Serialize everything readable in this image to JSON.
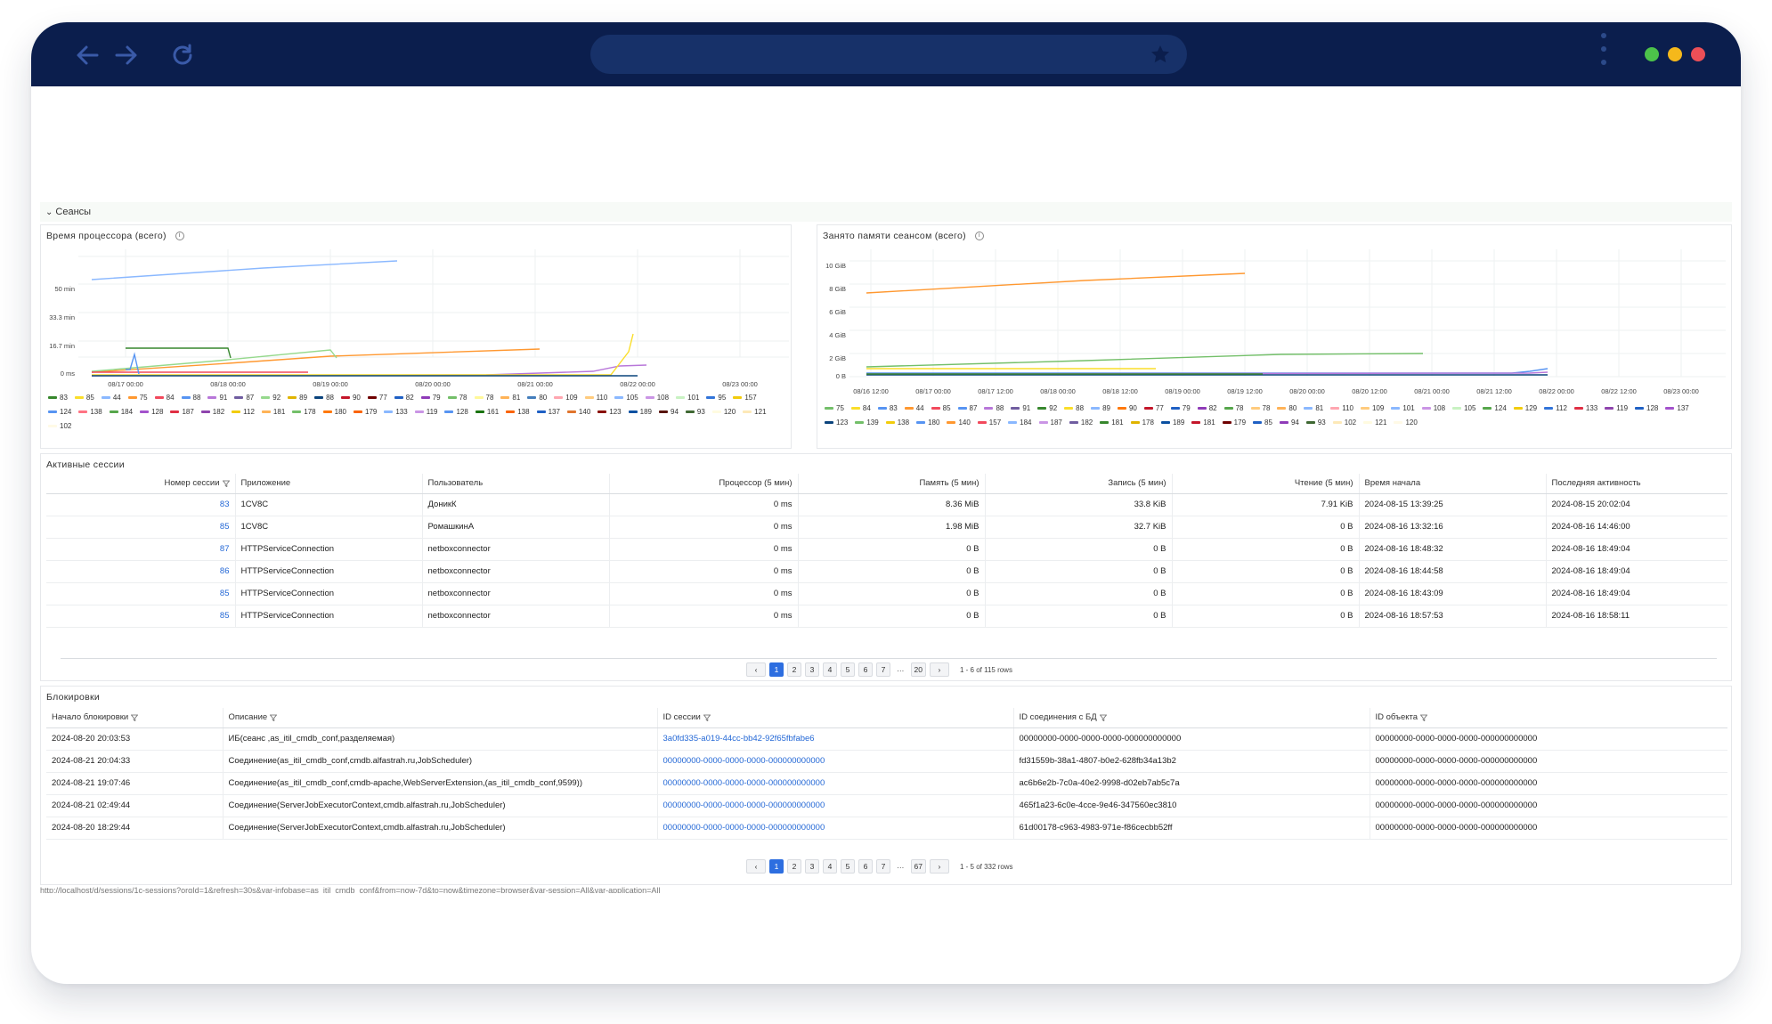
{
  "colors": {
    "titlebar": "#0b1e4d",
    "address_bar": "#173169",
    "accent": "#2d6ee0",
    "link": "#2468d6",
    "traffic_green": "#4cc24a",
    "traffic_yellow": "#f5b81b",
    "traffic_red": "#ec4f57"
  },
  "browser": {
    "icons": [
      "back-arrow-icon",
      "forward-arrow-icon",
      "reload-icon",
      "star-icon",
      "kebab-menu-icon"
    ]
  },
  "row": {
    "title": "Сеансы",
    "icon": "chevron-down-icon"
  },
  "cpu_panel": {
    "title": "Время процессора (всего)",
    "y_ticks": [
      "50 min",
      "33.3 min",
      "16.7 min",
      "0 ms"
    ],
    "x_ticks": [
      "08/17 00:00",
      "08/18 00:00",
      "08/19 00:00",
      "08/20 00:00",
      "08/21 00:00",
      "08/22 00:00",
      "08/23 00:00"
    ],
    "legend": [
      {
        "label": "83",
        "color": "#37872d"
      },
      {
        "label": "85",
        "color": "#fade2a"
      },
      {
        "label": "44",
        "color": "#8ab8ff"
      },
      {
        "label": "75",
        "color": "#ff9830"
      },
      {
        "label": "84",
        "color": "#f2495c"
      },
      {
        "label": "88",
        "color": "#5794f2"
      },
      {
        "label": "91",
        "color": "#b877d9"
      },
      {
        "label": "87",
        "color": "#705da0"
      },
      {
        "label": "92",
        "color": "#96d98d"
      },
      {
        "label": "89",
        "color": "#e0b400"
      },
      {
        "label": "88",
        "color": "#0a437c"
      },
      {
        "label": "90",
        "color": "#c4162a"
      },
      {
        "label": "77",
        "color": "#6f0000"
      },
      {
        "label": "82",
        "color": "#1f60c4"
      },
      {
        "label": "79",
        "color": "#8f3bb8"
      },
      {
        "label": "78",
        "color": "#73bf69"
      },
      {
        "label": "78",
        "color": "#fff899"
      },
      {
        "label": "81",
        "color": "#ffb357"
      },
      {
        "label": "80",
        "color": "#447ebc"
      },
      {
        "label": "109",
        "color": "#ffa6b0"
      },
      {
        "label": "110",
        "color": "#ffcb7d"
      },
      {
        "label": "105",
        "color": "#8ab8ff"
      },
      {
        "label": "108",
        "color": "#ca95e5"
      },
      {
        "label": "101",
        "color": "#c8f2c2"
      },
      {
        "label": "95",
        "color": "#3274d9"
      },
      {
        "label": "157",
        "color": "#f2cc0c"
      },
      {
        "label": "124",
        "color": "#5794f2"
      },
      {
        "label": "138",
        "color": "#ff7383"
      },
      {
        "label": "184",
        "color": "#56a64b"
      },
      {
        "label": "128",
        "color": "#a352cc"
      },
      {
        "label": "187",
        "color": "#e02f44"
      },
      {
        "label": "182",
        "color": "#8e44ad"
      },
      {
        "label": "112",
        "color": "#f2cc0c"
      },
      {
        "label": "181",
        "color": "#ffb357"
      },
      {
        "label": "178",
        "color": "#73bf69"
      },
      {
        "label": "180",
        "color": "#ff780a"
      },
      {
        "label": "179",
        "color": "#fa6400"
      },
      {
        "label": "133",
        "color": "#8ab8ff"
      },
      {
        "label": "119",
        "color": "#ca95e5"
      },
      {
        "label": "128",
        "color": "#5794f2"
      },
      {
        "label": "161",
        "color": "#19730e"
      },
      {
        "label": "138",
        "color": "#fa6400"
      },
      {
        "label": "137",
        "color": "#1f60c4"
      },
      {
        "label": "140",
        "color": "#e0752d"
      },
      {
        "label": "123",
        "color": "#890f02"
      },
      {
        "label": "189",
        "color": "#0a50a1"
      },
      {
        "label": "94",
        "color": "#58140c"
      },
      {
        "label": "93",
        "color": "#3f6833"
      },
      {
        "label": "120",
        "color": "#fffbe0"
      },
      {
        "label": "121",
        "color": "#fde9b8"
      },
      {
        "label": "102",
        "color": "#fffae6"
      }
    ]
  },
  "mem_panel": {
    "title": "Занято памяти сеансом (всего)",
    "y_ticks": [
      "10 GiB",
      "8 GiB",
      "6 GiB",
      "4 GiB",
      "2 GiB",
      "0 B"
    ],
    "x_ticks": [
      "08/16 12:00",
      "08/17 00:00",
      "08/17 12:00",
      "08/18 00:00",
      "08/18 12:00",
      "08/19 00:00",
      "08/19 12:00",
      "08/20 00:00",
      "08/20 12:00",
      "08/21 00:00",
      "08/21 12:00",
      "08/22 00:00",
      "08/22 12:00",
      "08/23 00:00"
    ],
    "legend": [
      {
        "label": "75",
        "color": "#73bf69"
      },
      {
        "label": "84",
        "color": "#fade2a"
      },
      {
        "label": "83",
        "color": "#5794f2"
      },
      {
        "label": "44",
        "color": "#ff9830"
      },
      {
        "label": "85",
        "color": "#f2495c"
      },
      {
        "label": "87",
        "color": "#5794f2"
      },
      {
        "label": "88",
        "color": "#b877d9"
      },
      {
        "label": "91",
        "color": "#705da0"
      },
      {
        "label": "92",
        "color": "#37872d"
      },
      {
        "label": "88",
        "color": "#fade2a"
      },
      {
        "label": "89",
        "color": "#8ab8ff"
      },
      {
        "label": "90",
        "color": "#ff780a"
      },
      {
        "label": "77",
        "color": "#c4162a"
      },
      {
        "label": "79",
        "color": "#1f60c4"
      },
      {
        "label": "82",
        "color": "#8f3bb8"
      },
      {
        "label": "78",
        "color": "#56a64b"
      },
      {
        "label": "78",
        "color": "#ffcb7d"
      },
      {
        "label": "80",
        "color": "#ffb357"
      },
      {
        "label": "81",
        "color": "#8ab8ff"
      },
      {
        "label": "110",
        "color": "#ffa6b0"
      },
      {
        "label": "109",
        "color": "#ffcb7d"
      },
      {
        "label": "101",
        "color": "#8ab8ff"
      },
      {
        "label": "108",
        "color": "#ca95e5"
      },
      {
        "label": "105",
        "color": "#c8f2c2"
      },
      {
        "label": "124",
        "color": "#56a64b"
      },
      {
        "label": "129",
        "color": "#f2cc0c"
      },
      {
        "label": "112",
        "color": "#3274d9"
      },
      {
        "label": "133",
        "color": "#e02f44"
      },
      {
        "label": "119",
        "color": "#8e44ad"
      },
      {
        "label": "128",
        "color": "#1f60c4"
      },
      {
        "label": "137",
        "color": "#a352cc"
      },
      {
        "label": "123",
        "color": "#0a437c"
      },
      {
        "label": "139",
        "color": "#73bf69"
      },
      {
        "label": "138",
        "color": "#f2cc0c"
      },
      {
        "label": "180",
        "color": "#5794f2"
      },
      {
        "label": "140",
        "color": "#ff9830"
      },
      {
        "label": "157",
        "color": "#f2495c"
      },
      {
        "label": "184",
        "color": "#8ab8ff"
      },
      {
        "label": "187",
        "color": "#ca95e5"
      },
      {
        "label": "182",
        "color": "#705da0"
      },
      {
        "label": "181",
        "color": "#37872d"
      },
      {
        "label": "178",
        "color": "#e0b400"
      },
      {
        "label": "189",
        "color": "#0a50a1"
      },
      {
        "label": "181",
        "color": "#c4162a"
      },
      {
        "label": "179",
        "color": "#6f0000"
      },
      {
        "label": "85",
        "color": "#1f60c4"
      },
      {
        "label": "94",
        "color": "#8f3bb8"
      },
      {
        "label": "93",
        "color": "#3f6833"
      },
      {
        "label": "102",
        "color": "#fde9b8"
      },
      {
        "label": "121",
        "color": "#fffbe0"
      },
      {
        "label": "120",
        "color": "#fffae6"
      }
    ]
  },
  "sessions": {
    "title": "Активные сессии",
    "columns": [
      "Номер сессии",
      "Приложение",
      "Пользователь",
      "Процессор (5 мин)",
      "Память (5 мин)",
      "Запись (5 мин)",
      "Чтение (5 мин)",
      "Время начала",
      "Последняя активность"
    ],
    "rows": [
      [
        "83",
        "1CV8C",
        "ДоникК",
        "0 ms",
        "8.36 MiB",
        "33.8 KiB",
        "7.91 KiB",
        "2024-08-15 13:39:25",
        "2024-08-15 20:02:04"
      ],
      [
        "85",
        "1CV8C",
        "РомашкинА",
        "0 ms",
        "1.98 MiB",
        "32.7 KiB",
        "0 B",
        "2024-08-16 13:32:16",
        "2024-08-16 14:46:00"
      ],
      [
        "87",
        "HTTPServiceConnection",
        "netboxconnector",
        "0 ms",
        "0 B",
        "0 B",
        "0 B",
        "2024-08-16 18:48:32",
        "2024-08-16 18:49:04"
      ],
      [
        "86",
        "HTTPServiceConnection",
        "netboxconnector",
        "0 ms",
        "0 B",
        "0 B",
        "0 B",
        "2024-08-16 18:44:58",
        "2024-08-16 18:49:04"
      ],
      [
        "85",
        "HTTPServiceConnection",
        "netboxconnector",
        "0 ms",
        "0 B",
        "0 B",
        "0 B",
        "2024-08-16 18:43:09",
        "2024-08-16 18:49:04"
      ],
      [
        "85",
        "HTTPServiceConnection",
        "netboxconnector",
        "0 ms",
        "0 B",
        "0 B",
        "0 B",
        "2024-08-16 18:57:53",
        "2024-08-16 18:58:11"
      ]
    ],
    "pager": {
      "pages": [
        "1",
        "2",
        "3",
        "4",
        "5",
        "6",
        "7",
        "…",
        "20"
      ],
      "active": "1",
      "info": "1 - 6 of 115 rows",
      "prev": "‹",
      "next": "›"
    }
  },
  "locks": {
    "title": "Блокировки",
    "columns": [
      "Начало блокировки",
      "Описание",
      "ID сессии",
      "ID соединения с БД",
      "ID объекта"
    ],
    "rows": [
      [
        "2024-08-20 20:03:53",
        "ИБ(сеанс ,as_itil_cmdb_conf,разделяемая)",
        "3a0fd335-a019-44cc-bb42-92f65fbfabe6",
        "00000000-0000-0000-0000-000000000000",
        "00000000-0000-0000-0000-000000000000"
      ],
      [
        "2024-08-21 20:04:33",
        "Соединение(as_itil_cmdb_conf,cmdb.alfastrah.ru,JobScheduler)",
        "00000000-0000-0000-0000-000000000000",
        "fd31559b-38a1-4807-b0e2-628fb34a13b2",
        "00000000-0000-0000-0000-000000000000"
      ],
      [
        "2024-08-21 19:07:46",
        "Соединение(as_itil_cmdb_conf,cmdb-apache,WebServerExtension,(as_itil_cmdb_conf,9599))",
        "00000000-0000-0000-0000-000000000000",
        "ac6b6e2b-7c0a-40e2-9998-d02eb7ab5c7a",
        "00000000-0000-0000-0000-000000000000"
      ],
      [
        "2024-08-21 02:49:44",
        "Соединение(ServerJobExecutorContext,cmdb.alfastrah.ru,JobScheduler)",
        "00000000-0000-0000-0000-000000000000",
        "465f1a23-6c0e-4cce-9e46-347560ec3810",
        "00000000-0000-0000-0000-000000000000"
      ],
      [
        "2024-08-20 18:29:44",
        "Соединение(ServerJobExecutorContext,cmdb.alfastrah.ru,JobScheduler)",
        "00000000-0000-0000-0000-000000000000",
        "61d00178-c963-4983-971e-f86cecbb52ff",
        "00000000-0000-0000-0000-000000000000"
      ]
    ],
    "pager": {
      "pages": [
        "1",
        "2",
        "3",
        "4",
        "5",
        "6",
        "7",
        "…",
        "67"
      ],
      "active": "1",
      "info": "1 - 5 of 332 rows",
      "prev": "‹",
      "next": "›"
    }
  },
  "footer": {
    "text": "http://localhost/d/sessions/1c-sessions?orgId=1&refresh=30s&var-infobase=as_itil_cmdb_conf&from=now-7d&to=now&timezone=browser&var-session=All&var-application=All"
  }
}
